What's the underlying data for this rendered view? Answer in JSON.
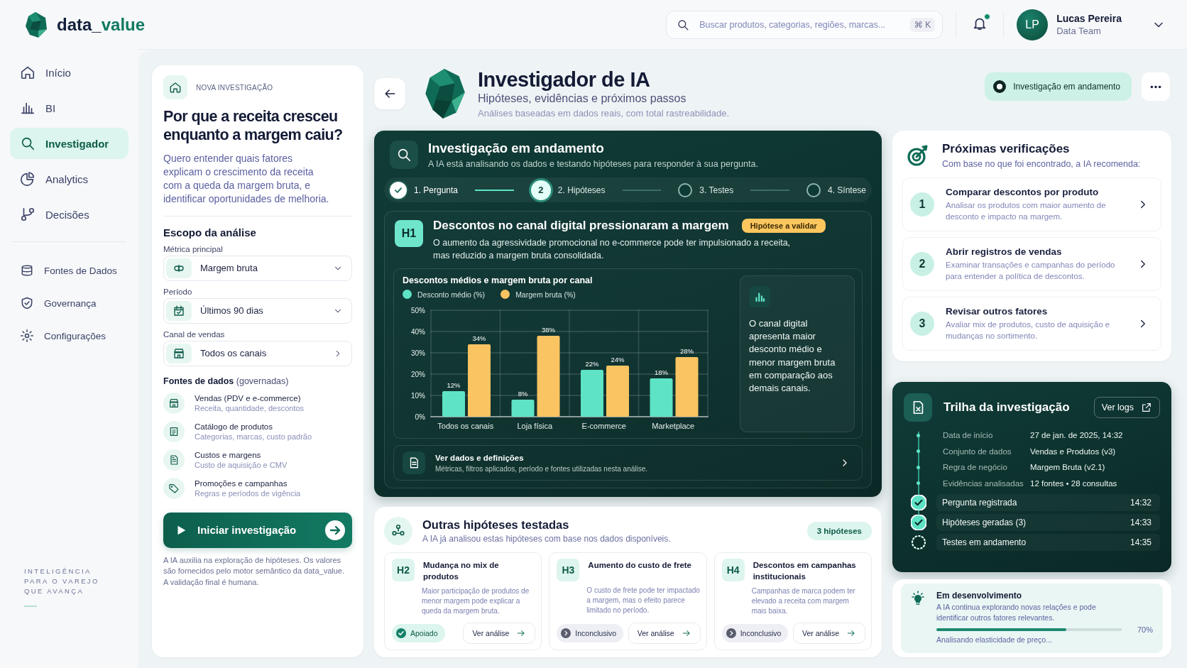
{
  "brand": {
    "prefix": "data_",
    "suffix": "value"
  },
  "search": {
    "placeholder": "Buscar produtos, categorias, regiões, marcas...",
    "shortcut": "⌘ K"
  },
  "notifications": {
    "unread": true
  },
  "user": {
    "initials": "LP",
    "name": "Lucas Pereira",
    "role": "Data Team"
  },
  "sidebar": {
    "primary": [
      {
        "label": "Início",
        "selected": false
      },
      {
        "label": "BI",
        "selected": false
      },
      {
        "label": "Investigador",
        "selected": true
      },
      {
        "label": "Analytics",
        "selected": false
      },
      {
        "label": "Decisões",
        "selected": false
      }
    ],
    "secondary": [
      {
        "label": "Fontes de Dados",
        "selected": false
      },
      {
        "label": "Governança",
        "selected": false
      },
      {
        "label": "Configurações",
        "selected": false
      }
    ],
    "tagline": [
      "INTELIGÊNCIA",
      "PARA O VAREJO",
      "QUE AVANÇA"
    ]
  },
  "new_investigation": {
    "kicker": "NOVA INVESTIGAÇÃO",
    "question": "Por que a receita cresceu enquanto a margem caiu?",
    "description": "Quero entender quais fatores explicam o crescimento da receita com a queda da margem bruta, e identificar oportunidades de melhoria.",
    "scope_title": "Escopo da análise",
    "fields": [
      {
        "label": "Métrica principal",
        "value": "Margem bruta",
        "kind": "select"
      },
      {
        "label": "Período",
        "value": "Últimos 90 dias",
        "kind": "select"
      },
      {
        "label": "Canal de vendas",
        "value": "Todos os canais",
        "kind": "link"
      }
    ],
    "sources_title": "**Fontes de dados** (governadas)",
    "sources": [
      {
        "title": "Vendas (PDV e e-commerce)",
        "description": "Receita, quantidade, descontos"
      },
      {
        "title": "Catálogo de produtos",
        "description": "Categorias, marcas, custo padrão"
      },
      {
        "title": "Custos e margens",
        "description": "Custo de aquisição e CMV"
      },
      {
        "title": "Promoções e campanhas",
        "description": "Regras e períodos de vigência"
      }
    ],
    "start_button": "Iniciar investigação",
    "disclaimer": "A IA auxilia na exploração de hipóteses. Os valores são fornecidos pelo motor semântico da data_value. A validação final é humana."
  },
  "page": {
    "title": "Investigador de IA",
    "subtitle": "Hipóteses, evidências e próximos passos",
    "note": "Análises baseadas em dados reais, com total rastreabilidade.",
    "status": "Investigação em andamento"
  },
  "investigation": {
    "title": "Investigação em andamento",
    "subtitle": "A IA está analisando os dados e testando hipóteses para responder à sua pergunta.",
    "steps": [
      {
        "label": "1. Pergunta",
        "done": true,
        "selected": false
      },
      {
        "label": "2. Hipóteses",
        "done": false,
        "selected": true,
        "number": "2"
      },
      {
        "label": "3. Testes",
        "done": false,
        "selected": false
      },
      {
        "label": "4. Síntese",
        "done": false,
        "selected": false
      }
    ],
    "hypothesis": {
      "code": "H1",
      "title": "Descontos no canal digital pressionaram a margem",
      "tag": "Hipótese a validar",
      "description": "O aumento da agressividade promocional no e-commerce pode ter impulsionado a receita, mas reduzido a margem bruta consolidada.",
      "chart_data": {
        "type": "bar",
        "title": "Descontos médios e margem bruta por canal",
        "categories": [
          "Todos os canais",
          "Loja física",
          "E-commerce",
          "Marketplace"
        ],
        "series": [
          {
            "name": "Desconto médio (%)",
            "color": "#5ee3c6",
            "values": [
              12,
              8,
              22,
              18
            ]
          },
          {
            "name": "Margem bruta (%)",
            "color": "#f9c461",
            "values": [
              34,
              38,
              24,
              28
            ]
          }
        ],
        "ylim": [
          0,
          50
        ],
        "grid": true,
        "legend": "top",
        "yticks": [
          {
            "value": 0,
            "label": "0%"
          },
          {
            "value": 10,
            "label": "10%"
          },
          {
            "value": 20,
            "label": "20%"
          },
          {
            "value": 30,
            "label": "30%"
          },
          {
            "value": 40,
            "label": "40%"
          },
          {
            "value": 50,
            "label": "50%"
          }
        ],
        "value_labels": [
          [
            "12%",
            "8%",
            "22%",
            "18%"
          ],
          [
            "34%",
            "38%",
            "24%",
            "28%"
          ]
        ]
      },
      "insight": "O canal digital apresenta maior desconto médio e menor margem bruta em comparação aos demais canais.",
      "details": {
        "title": "Ver dados e definições",
        "description": "Métricas, filtros aplicados, período e fontes utilizadas nesta análise."
      }
    }
  },
  "other_hypotheses": {
    "title": "Outras hipóteses testadas",
    "subtitle": "A IA já analisou estas hipóteses com base nos dados disponíveis.",
    "count": "3 hipóteses",
    "items": [
      {
        "code": "H2",
        "title": "Mudança no mix de produtos",
        "description": "Maior participação de produtos de menor margem pode explicar a queda da margem bruta.",
        "result": {
          "label": "Apoiado",
          "kind": "supported"
        },
        "action": "Ver análise"
      },
      {
        "code": "H3",
        "title": "Aumento do custo de frete",
        "description": "O custo de frete pode ter impactado a margem, mas o efeito parece limitado no período.",
        "result": {
          "label": "Inconclusivo",
          "kind": "inconclusive"
        },
        "action": "Ver análise"
      },
      {
        "code": "H4",
        "title": "Descontos em campanhas institucionais",
        "description": "Campanhas de marca podem ter elevado a receita com margem mais baixa.",
        "result": {
          "label": "Inconclusivo",
          "kind": "inconclusive"
        },
        "action": "Ver análise"
      }
    ]
  },
  "next_checks": {
    "title": "Próximas verificações",
    "subtitle": "Com base no que foi encontrado, a IA recomenda:",
    "items": [
      {
        "number": "1",
        "title": "Comparar descontos por produto",
        "description": "Analisar os produtos com maior aumento de desconto e impacto na margem."
      },
      {
        "number": "2",
        "title": "Abrir registros de vendas",
        "description": "Examinar transações e campanhas do período para entender a política de descontos."
      },
      {
        "number": "3",
        "title": "Revisar outros fatores",
        "description": "Avaliar mix de produtos, custo de aquisição e mudanças no sortimento."
      }
    ]
  },
  "trail": {
    "title": "Trilha da investigação",
    "logs_button": "Ver logs",
    "details": [
      {
        "label": "Data de início",
        "value": "27 de jan. de 2025, 14:32"
      },
      {
        "label": "Conjunto de dados",
        "value": "Vendas e Produtos (v3)"
      },
      {
        "label": "Regra de negócio",
        "value": "Margem Bruta (v2.1)"
      },
      {
        "label": "Evidências analisadas",
        "value": "12 fontes • 28 consultas"
      }
    ],
    "events": [
      {
        "label": "Pergunta registrada",
        "time": "14:32",
        "done": true
      },
      {
        "label": "Hipóteses geradas (3)",
        "time": "14:33",
        "done": true
      },
      {
        "label": "Testes em andamento",
        "time": "14:35",
        "done": false
      }
    ]
  },
  "in_progress": {
    "title": "Em desenvolvimento",
    "description": "A IA continua explorando novas relações e pode identificar outros fatores relevantes.",
    "level": 0.7,
    "reading": "70%",
    "caption": "Analisando elasticidade de preço..."
  }
}
